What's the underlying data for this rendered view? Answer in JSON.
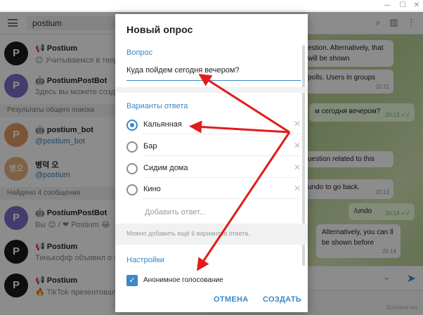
{
  "window": {
    "minimize": "—",
    "maximize": "☐",
    "close": "✕"
  },
  "search": {
    "value": "postium"
  },
  "chats": [
    {
      "title": "📢 Postium",
      "sub": "😊 Учитываемся в теор",
      "avatar": "P",
      "color": "#1a1a1a",
      "subclass": ""
    },
    {
      "title": "🤖 PostiumPostBot",
      "sub": "Здесь вы можете создат",
      "avatar": "P",
      "color": "#7b70c8",
      "subclass": ""
    }
  ],
  "section_global": "Результаты общего поиска",
  "global": [
    {
      "title": "🤖 postium_bot",
      "sub": "@postium_bot",
      "avatar": "P",
      "color": "#e39a66"
    },
    {
      "title": "병덕 오",
      "sub": "@postium",
      "avatar": "병오",
      "color": "#e7b27f"
    }
  ],
  "section_messages": "Найдено 4 сообщения",
  "messages": [
    {
      "title": "🤖 PostiumPostBot",
      "sub": "Вы 😊 / ❤ Postium 😂",
      "avatar": "P",
      "color": "#7b70c8"
    },
    {
      "title": "📢 Postium",
      "sub": "Тинькофф объявил о зап",
      "avatar": "P",
      "color": "#1a1a1a"
    },
    {
      "title": "📢 Postium",
      "sub": "🔥 TikTok презентовал с",
      "avatar": "P",
      "color": "#1a1a1a"
    }
  ],
  "bubbles": [
    {
      "text": "estion. Alternatively, that will be shown",
      "time": "",
      "out": false
    },
    {
      "text": "polls. Users in groups",
      "time": "20:11",
      "out": false
    },
    {
      "text": "м сегодня вечером?",
      "time": "20:13 ✓✓",
      "out": true
    },
    {
      "text": "uestion related to this",
      "time": "",
      "out": false
    },
    {
      "text": "undo to go back.",
      "time": "20:13",
      "out": false
    },
    {
      "text": "/undo",
      "time": "20:14 ✓✓",
      "out": true
    },
    {
      "text": "Alternatively, you can ll be shown before",
      "time": "20:14",
      "out": false
    }
  ],
  "watermark": "Sovmled.net",
  "modal": {
    "title": "Новый опрос",
    "question_label": "Вопрос",
    "question": "Куда пойдем сегодня вечером?",
    "options_label": "Варианты ответа",
    "options": [
      {
        "label": "Кальянная",
        "selected": true
      },
      {
        "label": "Бар",
        "selected": false
      },
      {
        "label": "Сидим дома",
        "selected": false
      },
      {
        "label": "Кино",
        "selected": false
      }
    ],
    "remove_glyph": "✕",
    "add_placeholder": "Добавить ответ...",
    "hint": "Можно добавить ещё 6 вариантов ответа.",
    "settings_label": "Настройки",
    "anonymous_label": "Анонимное голосование",
    "check_glyph": "✓",
    "cancel": "ОТМЕНА",
    "create": "СОЗДАТЬ"
  },
  "colors": {
    "accent": "#3a88c8",
    "arrow": "#e21b1b"
  }
}
